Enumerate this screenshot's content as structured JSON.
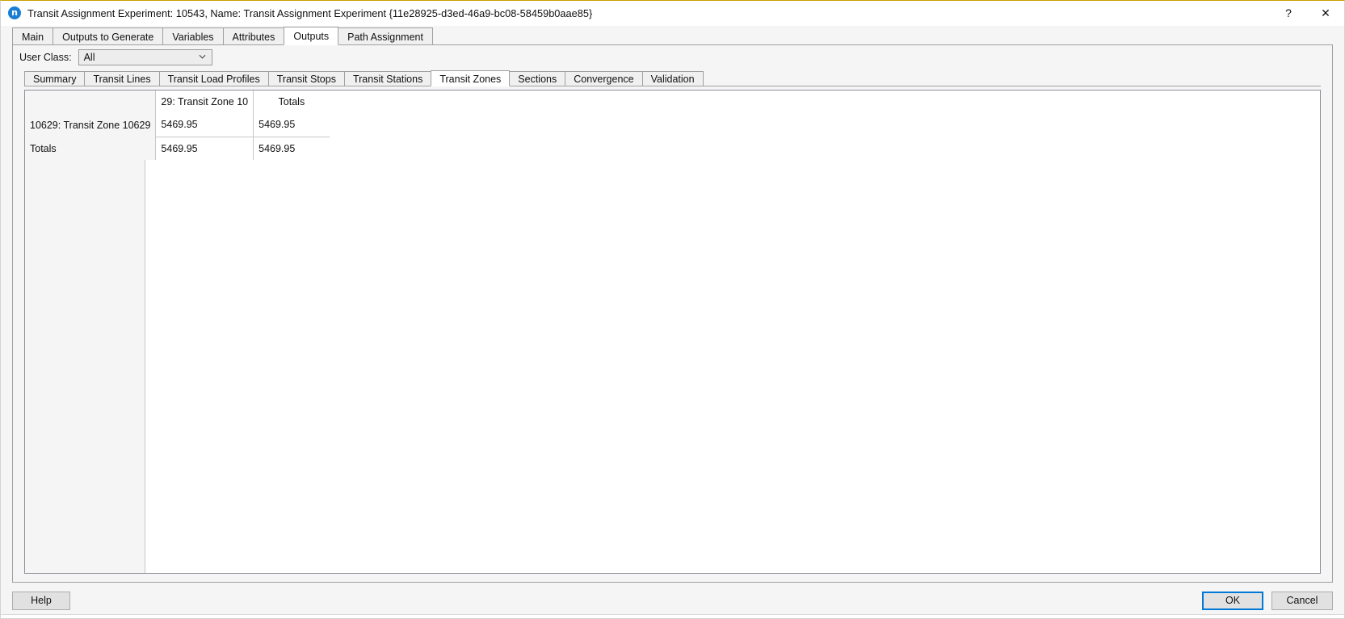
{
  "window": {
    "title": "Transit Assignment Experiment: 10543, Name: Transit Assignment Experiment  {11e28925-d3ed-46a9-bc08-58459b0aae85}",
    "app_icon_letter": "n",
    "help_glyph": "?",
    "close_glyph": "✕",
    "accent_color": "#0078d7",
    "icon_color": "#1a7fd4"
  },
  "main_tabs": [
    {
      "label": "Main",
      "active": false
    },
    {
      "label": "Outputs to Generate",
      "active": false
    },
    {
      "label": "Variables",
      "active": false
    },
    {
      "label": "Attributes",
      "active": false
    },
    {
      "label": "Outputs",
      "active": true
    },
    {
      "label": "Path Assignment",
      "active": false
    }
  ],
  "user_class": {
    "label": "User Class:",
    "value": "All",
    "placeholder": "All"
  },
  "sub_tabs": [
    {
      "label": "Summary",
      "active": false
    },
    {
      "label": "Transit Lines",
      "active": false
    },
    {
      "label": "Transit Load Profiles",
      "active": false
    },
    {
      "label": "Transit Stops",
      "active": false
    },
    {
      "label": "Transit Stations",
      "active": false
    },
    {
      "label": "Transit Zones",
      "active": true
    },
    {
      "label": "Sections",
      "active": false
    },
    {
      "label": "Convergence",
      "active": false
    },
    {
      "label": "Validation",
      "active": false
    }
  ],
  "table": {
    "corner": "",
    "column_headers": [
      "29: Transit Zone 10",
      "Totals"
    ],
    "rows": [
      {
        "header": "10629: Transit Zone 10629",
        "values": [
          "5469.95",
          "5469.95"
        ]
      },
      {
        "header": "Totals",
        "values": [
          "5469.95",
          "5469.95"
        ]
      }
    ]
  },
  "buttons": {
    "help": "Help",
    "ok": "OK",
    "cancel": "Cancel"
  }
}
